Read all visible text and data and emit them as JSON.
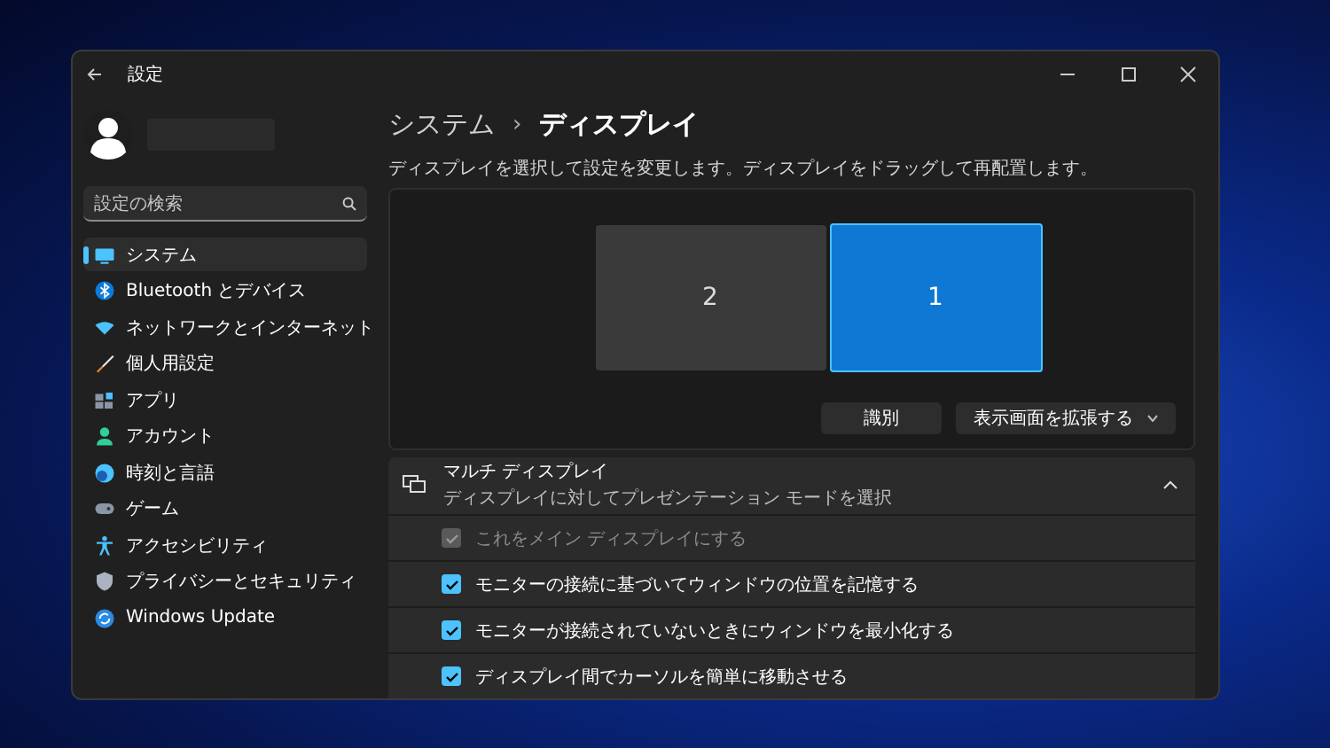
{
  "window": {
    "title": "設定"
  },
  "search": {
    "placeholder": "設定の検索"
  },
  "nav": [
    {
      "label": "システム",
      "selected": true,
      "kind": "system"
    },
    {
      "label": "Bluetooth とデバイス",
      "selected": false,
      "kind": "bluetooth"
    },
    {
      "label": "ネットワークとインターネット",
      "selected": false,
      "kind": "network"
    },
    {
      "label": "個人用設定",
      "selected": false,
      "kind": "brush"
    },
    {
      "label": "アプリ",
      "selected": false,
      "kind": "apps"
    },
    {
      "label": "アカウント",
      "selected": false,
      "kind": "account"
    },
    {
      "label": "時刻と言語",
      "selected": false,
      "kind": "time"
    },
    {
      "label": "ゲーム",
      "selected": false,
      "kind": "game"
    },
    {
      "label": "アクセシビリティ",
      "selected": false,
      "kind": "access"
    },
    {
      "label": "プライバシーとセキュリティ",
      "selected": false,
      "kind": "shield"
    },
    {
      "label": "Windows Update",
      "selected": false,
      "kind": "update"
    }
  ],
  "breadcrumb": {
    "parent": "システム",
    "separator": "›",
    "current": "ディスプレイ"
  },
  "description": "ディスプレイを選択して設定を変更します。ディスプレイをドラッグして再配置します。",
  "monitors": [
    {
      "label": "2",
      "selected": false
    },
    {
      "label": "1",
      "selected": true
    }
  ],
  "buttons": {
    "identify": "識別",
    "mode": "表示画面を拡張する"
  },
  "multi_display": {
    "title": "マルチ ディスプレイ",
    "subtitle": "ディスプレイに対してプレゼンテーション モードを選択",
    "expanded": true,
    "options": [
      {
        "label": "これをメイン ディスプレイにする",
        "checked": true,
        "disabled": true
      },
      {
        "label": "モニターの接続に基づいてウィンドウの位置を記憶する",
        "checked": true,
        "disabled": false
      },
      {
        "label": "モニターが接続されていないときにウィンドウを最小化する",
        "checked": true,
        "disabled": false
      },
      {
        "label": "ディスプレイ間でカーソルを簡単に移動させる",
        "checked": true,
        "disabled": false
      }
    ]
  }
}
